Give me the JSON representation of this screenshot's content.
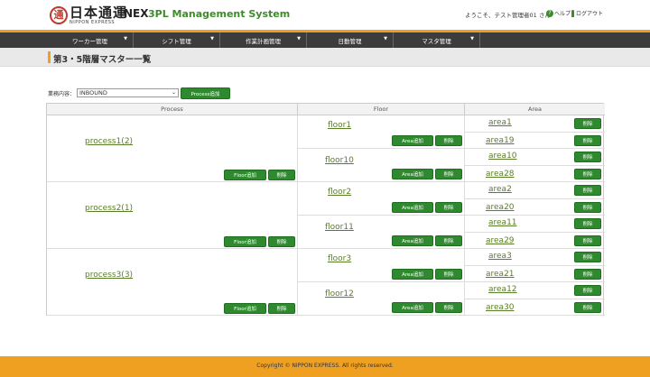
{
  "header": {
    "logo_mark": "通",
    "brand_jp": "日本通運",
    "brand_en": "NIPPON EXPRESS",
    "system_nex": "NEX",
    "system_title": "3PL Management System",
    "user_greeting": "ようこそ、テスト管理者01 さん",
    "help_label": "ヘルプ",
    "logout_label": "ログアウト"
  },
  "nav": [
    {
      "label": "ワーカー管理"
    },
    {
      "label": "シフト管理"
    },
    {
      "label": "作業計画管理"
    },
    {
      "label": "日勤管理"
    },
    {
      "label": "マスタ管理"
    }
  ],
  "page": {
    "title": "第3・5階層マスター一覧"
  },
  "controls": {
    "business_label": "業務内容：",
    "business_value": "INBOUND",
    "add_process_label": "Process追加"
  },
  "table": {
    "headers": {
      "process": "Process",
      "floor": "Floor",
      "area": "Area"
    },
    "processes": [
      {
        "name": "process1(2)",
        "floors": [
          {
            "name": "floor1",
            "areas": [
              "area1",
              "area19"
            ]
          },
          {
            "name": "floor10",
            "areas": [
              "area10",
              "area28"
            ]
          }
        ]
      },
      {
        "name": "process2(1)",
        "floors": [
          {
            "name": "floor2",
            "areas": [
              "area2",
              "area20"
            ]
          },
          {
            "name": "floor11",
            "areas": [
              "area11",
              "area29"
            ]
          }
        ]
      },
      {
        "name": "process3(3)",
        "floors": [
          {
            "name": "floor3",
            "areas": [
              "area3",
              "area21"
            ]
          },
          {
            "name": "floor12",
            "areas": [
              "area12",
              "area30"
            ]
          }
        ]
      }
    ],
    "add_floor_label": "Floor追加",
    "add_area_label": "Area追加",
    "delete_label": "削除"
  },
  "footer": {
    "copyright": "Copyright © NIPPON EXPRESS. All rights reserved."
  },
  "colors": {
    "accent_orange": "#f0a020",
    "nav_dark": "#3c3c3c",
    "button_green": "#2f8a2f",
    "link_green": "#5a7d2a"
  }
}
